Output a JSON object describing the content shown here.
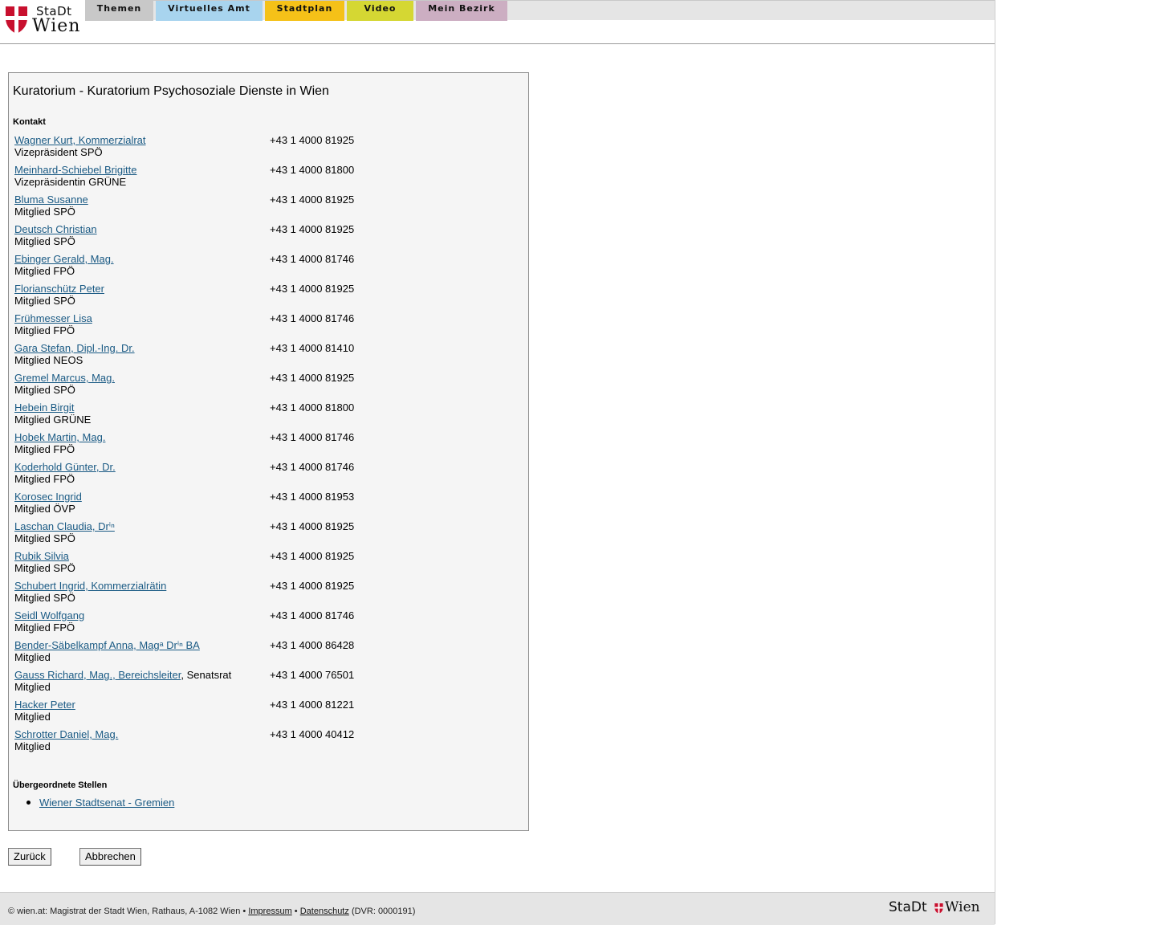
{
  "header": {
    "logo": {
      "top": "StaDt",
      "bottom": "Wien"
    },
    "tabs": [
      {
        "label": "Themen",
        "color": "#c8c8c8"
      },
      {
        "label": "Virtuelles Amt",
        "color": "#a8d4ee"
      },
      {
        "label": "Stadtplan",
        "color": "#f5c118"
      },
      {
        "label": "Video",
        "color": "#d5d733"
      },
      {
        "label": "Mein Bezirk",
        "color": "#ccaec2"
      }
    ]
  },
  "main": {
    "title": "Kuratorium - Kuratorium Psychosoziale Dienste in Wien",
    "contact_heading": "Kontakt",
    "contacts": [
      {
        "name": "Wagner Kurt, Kommerzialrat",
        "suffix": "",
        "role": "Vizepräsident SPÖ",
        "phone": "+43 1 4000 81925"
      },
      {
        "name": "Meinhard-Schiebel Brigitte",
        "suffix": "",
        "role": "Vizepräsidentin GRÜNE",
        "phone": "+43 1 4000 81800"
      },
      {
        "name": "Bluma Susanne",
        "suffix": "",
        "role": "Mitglied SPÖ",
        "phone": "+43 1 4000 81925"
      },
      {
        "name": "Deutsch Christian",
        "suffix": "",
        "role": "Mitglied SPÖ",
        "phone": "+43 1 4000 81925"
      },
      {
        "name": "Ebinger Gerald, Mag.",
        "suffix": "",
        "role": "Mitglied FPÖ",
        "phone": "+43 1 4000 81746"
      },
      {
        "name": "Florianschütz Peter",
        "suffix": "",
        "role": "Mitglied SPÖ",
        "phone": "+43 1 4000 81925"
      },
      {
        "name": "Frühmesser Lisa",
        "suffix": "",
        "role": "Mitglied FPÖ",
        "phone": "+43 1 4000 81746"
      },
      {
        "name": "Gara Stefan, Dipl.-Ing. Dr.",
        "suffix": "",
        "role": "Mitglied NEOS",
        "phone": "+43 1 4000 81410"
      },
      {
        "name": "Gremel Marcus, Mag.",
        "suffix": "",
        "role": "Mitglied SPÖ",
        "phone": "+43 1 4000 81925"
      },
      {
        "name": "Hebein Birgit",
        "suffix": "",
        "role": "Mitglied GRÜNE",
        "phone": "+43 1 4000 81800"
      },
      {
        "name": "Hobek Martin, Mag.",
        "suffix": "",
        "role": "Mitglied FPÖ",
        "phone": "+43 1 4000 81746"
      },
      {
        "name": "Koderhold Günter, Dr.",
        "suffix": "",
        "role": "Mitglied FPÖ",
        "phone": "+43 1 4000 81746"
      },
      {
        "name": "Korosec Ingrid",
        "suffix": "",
        "role": "Mitglied ÖVP",
        "phone": "+43 1 4000 81953"
      },
      {
        "name": "Laschan Claudia, Drⁱⁿ",
        "suffix": "",
        "role": "Mitglied SPÖ",
        "phone": "+43 1 4000 81925"
      },
      {
        "name": "Rubik Silvia",
        "suffix": "",
        "role": "Mitglied SPÖ",
        "phone": "+43 1 4000 81925"
      },
      {
        "name": "Schubert Ingrid, Kommerzialrätin",
        "suffix": "",
        "role": "Mitglied SPÖ",
        "phone": "+43 1 4000 81925"
      },
      {
        "name": "Seidl Wolfgang",
        "suffix": "",
        "role": "Mitglied FPÖ",
        "phone": "+43 1 4000 81746"
      },
      {
        "name": "Bender-Säbelkampf Anna, Magᵃ Drⁱⁿ BA",
        "suffix": "",
        "role": "Mitglied",
        "phone": "+43 1 4000 86428"
      },
      {
        "name": "Gauss Richard, Mag., Bereichsleiter",
        "suffix": ", Senatsrat",
        "role": "Mitglied",
        "phone": "+43 1 4000 76501"
      },
      {
        "name": "Hacker Peter",
        "suffix": "",
        "role": "Mitglied",
        "phone": "+43 1 4000 81221"
      },
      {
        "name": "Schrotter Daniel, Mag.",
        "suffix": "",
        "role": "Mitglied",
        "phone": "+43 1 4000 40412"
      }
    ],
    "parent_heading": "Übergeordnete Stellen",
    "parent_links": [
      "Wiener Stadtsenat - Gremien"
    ]
  },
  "buttons": {
    "back": "Zurück",
    "cancel": "Abbrechen"
  },
  "footer": {
    "text_pre": "© wien.at: Magistrat der Stadt Wien, Rathaus, A-1082 Wien •",
    "impressum": "Impressum",
    "sep": "•",
    "datenschutz": "Datenschutz",
    "dvr": "(DVR: 0000191)",
    "logo_left": "StaDt",
    "logo_right": "Wien"
  },
  "colors": {
    "link": "#1a5a84",
    "brand_red": "#c8102e",
    "panel_bg": "#f5f5f5"
  }
}
